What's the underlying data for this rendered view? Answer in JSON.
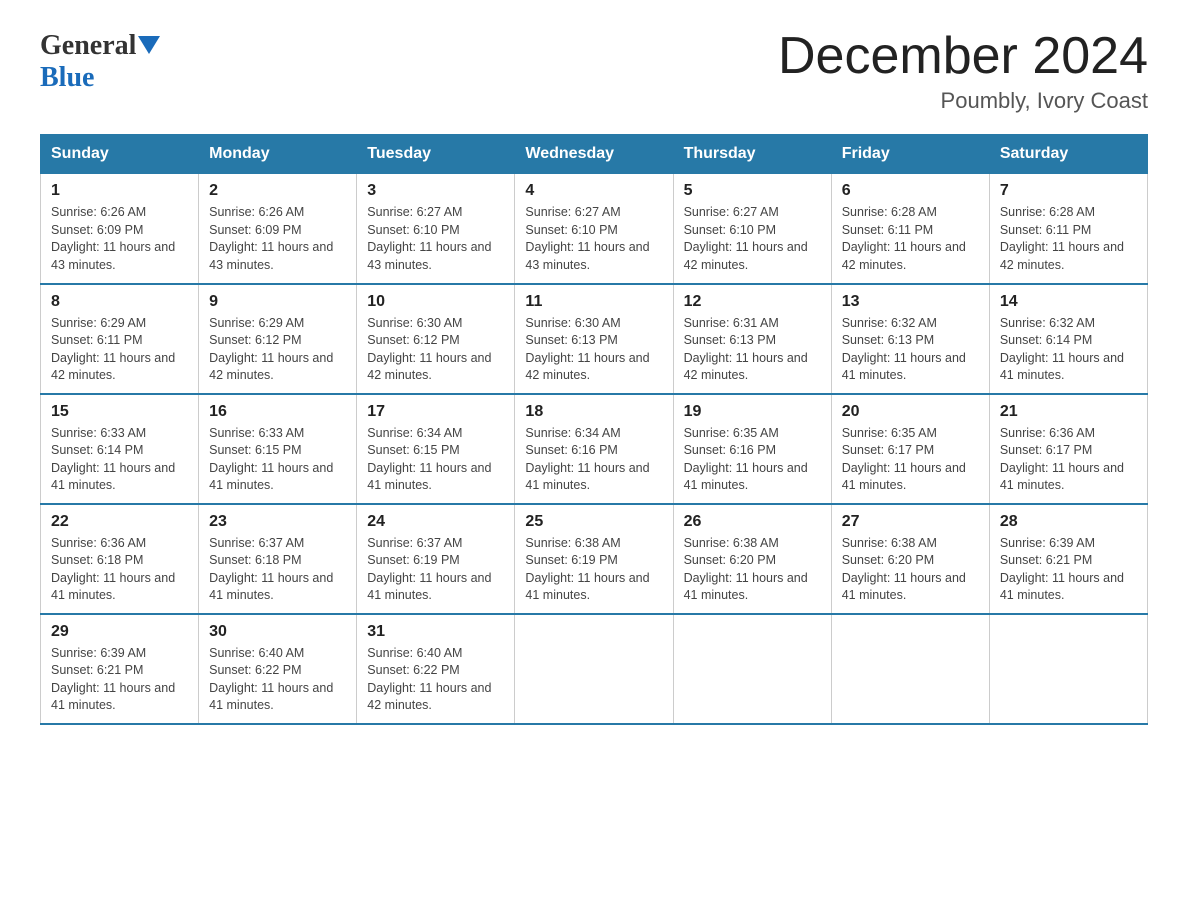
{
  "header": {
    "logo_general": "General",
    "logo_blue": "Blue",
    "month_year": "December 2024",
    "location": "Poumbly, Ivory Coast"
  },
  "days_of_week": [
    "Sunday",
    "Monday",
    "Tuesday",
    "Wednesday",
    "Thursday",
    "Friday",
    "Saturday"
  ],
  "weeks": [
    [
      {
        "day": "1",
        "sunrise": "6:26 AM",
        "sunset": "6:09 PM",
        "daylight": "11 hours and 43 minutes."
      },
      {
        "day": "2",
        "sunrise": "6:26 AM",
        "sunset": "6:09 PM",
        "daylight": "11 hours and 43 minutes."
      },
      {
        "day": "3",
        "sunrise": "6:27 AM",
        "sunset": "6:10 PM",
        "daylight": "11 hours and 43 minutes."
      },
      {
        "day": "4",
        "sunrise": "6:27 AM",
        "sunset": "6:10 PM",
        "daylight": "11 hours and 43 minutes."
      },
      {
        "day": "5",
        "sunrise": "6:27 AM",
        "sunset": "6:10 PM",
        "daylight": "11 hours and 42 minutes."
      },
      {
        "day": "6",
        "sunrise": "6:28 AM",
        "sunset": "6:11 PM",
        "daylight": "11 hours and 42 minutes."
      },
      {
        "day": "7",
        "sunrise": "6:28 AM",
        "sunset": "6:11 PM",
        "daylight": "11 hours and 42 minutes."
      }
    ],
    [
      {
        "day": "8",
        "sunrise": "6:29 AM",
        "sunset": "6:11 PM",
        "daylight": "11 hours and 42 minutes."
      },
      {
        "day": "9",
        "sunrise": "6:29 AM",
        "sunset": "6:12 PM",
        "daylight": "11 hours and 42 minutes."
      },
      {
        "day": "10",
        "sunrise": "6:30 AM",
        "sunset": "6:12 PM",
        "daylight": "11 hours and 42 minutes."
      },
      {
        "day": "11",
        "sunrise": "6:30 AM",
        "sunset": "6:13 PM",
        "daylight": "11 hours and 42 minutes."
      },
      {
        "day": "12",
        "sunrise": "6:31 AM",
        "sunset": "6:13 PM",
        "daylight": "11 hours and 42 minutes."
      },
      {
        "day": "13",
        "sunrise": "6:32 AM",
        "sunset": "6:13 PM",
        "daylight": "11 hours and 41 minutes."
      },
      {
        "day": "14",
        "sunrise": "6:32 AM",
        "sunset": "6:14 PM",
        "daylight": "11 hours and 41 minutes."
      }
    ],
    [
      {
        "day": "15",
        "sunrise": "6:33 AM",
        "sunset": "6:14 PM",
        "daylight": "11 hours and 41 minutes."
      },
      {
        "day": "16",
        "sunrise": "6:33 AM",
        "sunset": "6:15 PM",
        "daylight": "11 hours and 41 minutes."
      },
      {
        "day": "17",
        "sunrise": "6:34 AM",
        "sunset": "6:15 PM",
        "daylight": "11 hours and 41 minutes."
      },
      {
        "day": "18",
        "sunrise": "6:34 AM",
        "sunset": "6:16 PM",
        "daylight": "11 hours and 41 minutes."
      },
      {
        "day": "19",
        "sunrise": "6:35 AM",
        "sunset": "6:16 PM",
        "daylight": "11 hours and 41 minutes."
      },
      {
        "day": "20",
        "sunrise": "6:35 AM",
        "sunset": "6:17 PM",
        "daylight": "11 hours and 41 minutes."
      },
      {
        "day": "21",
        "sunrise": "6:36 AM",
        "sunset": "6:17 PM",
        "daylight": "11 hours and 41 minutes."
      }
    ],
    [
      {
        "day": "22",
        "sunrise": "6:36 AM",
        "sunset": "6:18 PM",
        "daylight": "11 hours and 41 minutes."
      },
      {
        "day": "23",
        "sunrise": "6:37 AM",
        "sunset": "6:18 PM",
        "daylight": "11 hours and 41 minutes."
      },
      {
        "day": "24",
        "sunrise": "6:37 AM",
        "sunset": "6:19 PM",
        "daylight": "11 hours and 41 minutes."
      },
      {
        "day": "25",
        "sunrise": "6:38 AM",
        "sunset": "6:19 PM",
        "daylight": "11 hours and 41 minutes."
      },
      {
        "day": "26",
        "sunrise": "6:38 AM",
        "sunset": "6:20 PM",
        "daylight": "11 hours and 41 minutes."
      },
      {
        "day": "27",
        "sunrise": "6:38 AM",
        "sunset": "6:20 PM",
        "daylight": "11 hours and 41 minutes."
      },
      {
        "day": "28",
        "sunrise": "6:39 AM",
        "sunset": "6:21 PM",
        "daylight": "11 hours and 41 minutes."
      }
    ],
    [
      {
        "day": "29",
        "sunrise": "6:39 AM",
        "sunset": "6:21 PM",
        "daylight": "11 hours and 41 minutes."
      },
      {
        "day": "30",
        "sunrise": "6:40 AM",
        "sunset": "6:22 PM",
        "daylight": "11 hours and 41 minutes."
      },
      {
        "day": "31",
        "sunrise": "6:40 AM",
        "sunset": "6:22 PM",
        "daylight": "11 hours and 42 minutes."
      },
      null,
      null,
      null,
      null
    ]
  ]
}
